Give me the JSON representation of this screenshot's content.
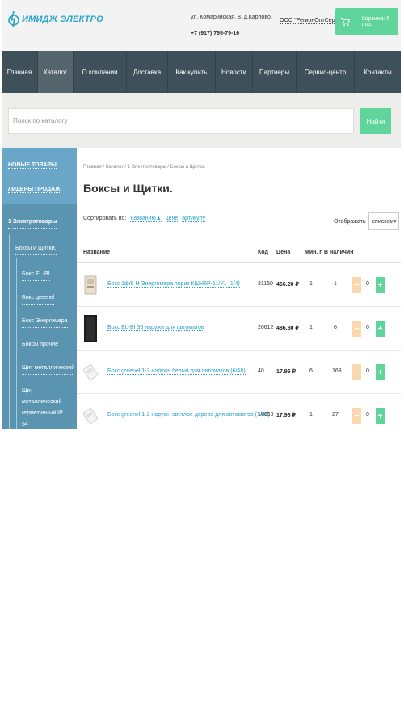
{
  "header": {
    "logo_text": "ИМИДЖ ЭЛЕКТРО",
    "address": "ул. Комаринская, 8, д.Карпово.",
    "phone": "+7 (917) 795-79-16",
    "company": "ООО \"РегионОптСервис\"",
    "cart_label": "Корзина: 5 поз."
  },
  "nav": [
    "Главная",
    "Каталог",
    "О компании",
    "Доставка",
    "Как купить",
    "Новости",
    "Партнеры",
    "Сервис-центр",
    "Контакты"
  ],
  "search": {
    "placeholder": "Поиск по каталогу",
    "button": "Найти"
  },
  "sidebar": {
    "top_links": [
      "НОВЫЕ ТОВАРЫ",
      "ЛИДЕРЫ ПРОДАЖ"
    ],
    "category": "1 Электротовары",
    "subcategory": "Боксы и Щитки.",
    "items": [
      "Бокс EL-BI",
      "Бокс greenel",
      "Бокс Энергомера",
      "Боксы прочие",
      "Щит металлический",
      "Щит металлический герметичный IP 54"
    ]
  },
  "main": {
    "breadcrumb": "Главная / Каталог / 1 Электротовары / Боксы и Щитки.",
    "title": "Боксы и Щитки.",
    "sort_label": "Сортировать по:",
    "sort_options": [
      "названию▲",
      "цене",
      "артикулу"
    ],
    "display_label": "Отображать",
    "display_value": "списком",
    "columns": [
      "Название",
      "Код",
      "Цена",
      "Мин. п",
      "В наличии"
    ],
    "products": [
      {
        "name": "Бокс 1ф/6 Н Энергомера пориз КШН6Р-11/У1 (1/4)",
        "code": "21150",
        "price": "466.20 ₽",
        "min": "1",
        "stock": "1",
        "qty": "0"
      },
      {
        "name": "Бокс EL-BI 36 наружн для автоматов",
        "code": "20612",
        "price": "486.80 ₽",
        "min": "1",
        "stock": "6",
        "qty": "0"
      },
      {
        "name": "Бокс greenel 1-2 наружн белый для автоматов (6/48)",
        "code": "40",
        "price": "17.96 ₽",
        "min": "6",
        "stock": "168",
        "qty": "0"
      },
      {
        "name": "Бокс greenel 1-2 наружн светлое дерево для автоматов (1/48)",
        "code": "16059",
        "price": "17.96 ₽",
        "min": "1",
        "stock": "27",
        "qty": "0"
      }
    ]
  },
  "colors": {
    "accent": "#29a3c9",
    "green": "#5fd49b",
    "nav_bg": "#3e5059",
    "sidebar_bg": "#5b94b1"
  },
  "icons": {
    "cart": "cart-icon",
    "logo": "logo-mark-icon",
    "dropdown": "chevron-down-icon"
  }
}
